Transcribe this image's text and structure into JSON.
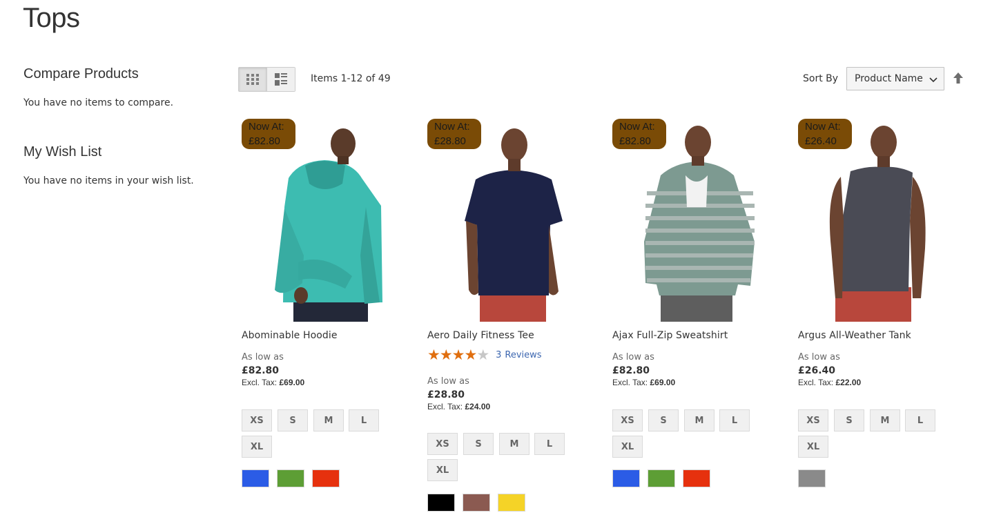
{
  "page": {
    "title": "Tops"
  },
  "sidebar": {
    "compare": {
      "title": "Compare Products",
      "empty": "You have no items to compare."
    },
    "wishlist": {
      "title": "My Wish List",
      "empty": "You have no items in your wish list."
    }
  },
  "toolbar": {
    "grid_icon": "grid-view-icon",
    "list_icon": "list-view-icon",
    "amount": "Items 1-12 of 49",
    "sort_label": "Sort By",
    "sort_value": "Product Name",
    "sort_direction_icon": "arrow-up-icon"
  },
  "products": [
    {
      "name": "Abominable Hoodie",
      "badge_line1": "Now At:",
      "badge_line2": "£82.80",
      "as_low_as": "As low as",
      "price": "£82.80",
      "excl_label": "Excl. Tax:",
      "excl_price": "£69.00",
      "sizes": [
        "XS",
        "S",
        "M",
        "L",
        "XL"
      ],
      "colors": [
        "#2b5ce6",
        "#5d9e35",
        "#e6310e"
      ],
      "garment_color": "#3dbcb1"
    },
    {
      "name": "Aero Daily Fitness Tee",
      "badge_line1": "Now At:",
      "badge_line2": "£28.80",
      "rating": 4,
      "rating_max": 5,
      "reviews_count": "3",
      "reviews_label": "Reviews",
      "as_low_as": "As low as",
      "price": "£28.80",
      "excl_label": "Excl. Tax:",
      "excl_price": "£24.00",
      "sizes": [
        "XS",
        "S",
        "M",
        "L",
        "XL"
      ],
      "colors": [
        "#000000",
        "#8b5a51",
        "#f5d327"
      ],
      "garment_color": "#1d2347"
    },
    {
      "name": "Ajax Full-Zip Sweatshirt",
      "badge_line1": "Now At:",
      "badge_line2": "£82.80",
      "as_low_as": "As low as",
      "price": "£82.80",
      "excl_label": "Excl. Tax:",
      "excl_price": "£69.00",
      "sizes": [
        "XS",
        "S",
        "M",
        "L",
        "XL"
      ],
      "colors": [
        "#2b5ce6",
        "#5d9e35",
        "#e6310e"
      ],
      "garment_color": "#7d9a91"
    },
    {
      "name": "Argus All-Weather Tank",
      "badge_line1": "Now At:",
      "badge_line2": "£26.40",
      "as_low_as": "As low as",
      "price": "£26.40",
      "excl_label": "Excl. Tax:",
      "excl_price": "£22.00",
      "sizes": [
        "XS",
        "S",
        "M",
        "L",
        "XL"
      ],
      "colors": [
        "#8a8a8a"
      ],
      "garment_color": "#4a4b55"
    }
  ]
}
